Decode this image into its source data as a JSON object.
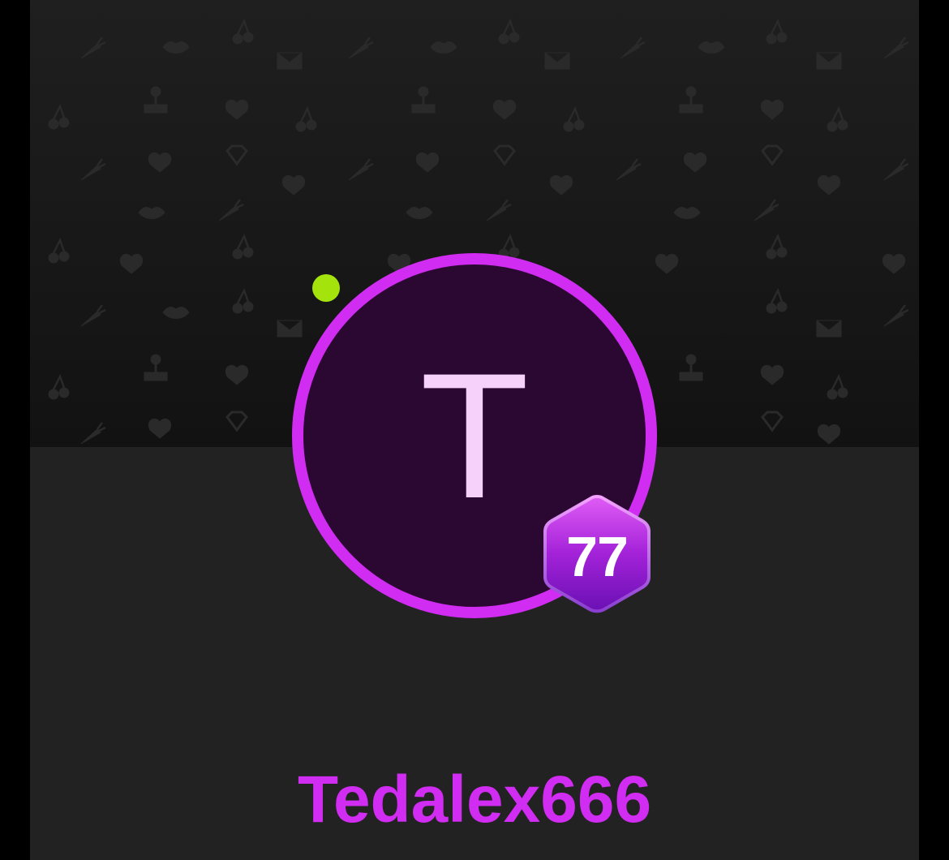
{
  "profile": {
    "avatar_initial": "T",
    "username": "Tedalex666",
    "level": "77",
    "online": true,
    "status_color": "#a4e40c"
  },
  "theme": {
    "accent": "#d12cf2",
    "avatar_background": "#2b0832",
    "avatar_initial_color": "#f6d2fb",
    "cover_background": "#1a1a1a",
    "page_background": "#222222"
  },
  "icons": {
    "cover_pattern": [
      "lips-icon",
      "cherry-icon",
      "carrot-icon",
      "envelope-icon",
      "heart-icon",
      "diamond-heart-icon",
      "person-icon"
    ],
    "level_badge": "hexagon-badge-icon"
  }
}
